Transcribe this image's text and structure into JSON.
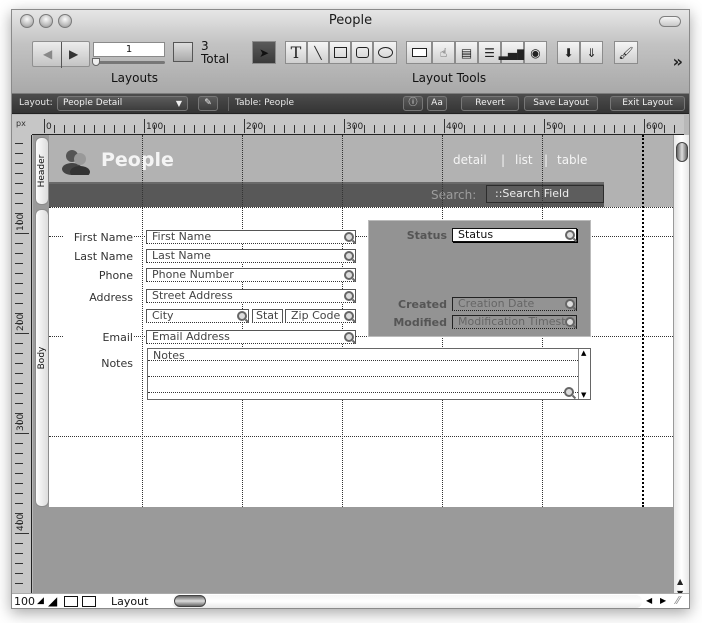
{
  "window": {
    "title": "People"
  },
  "toolbar": {
    "record_number": "1",
    "total_count": "3",
    "total_label": "Total",
    "layouts_label": "Layouts",
    "layout_tools_label": "Layout Tools",
    "more_label": "»",
    "tools": [
      "pointer",
      "text",
      "line",
      "rectangle",
      "rounded-rectangle",
      "oval",
      "field",
      "button",
      "tab-control",
      "portal",
      "chart",
      "web-viewer",
      "field-picker",
      "part-picker",
      "format-painter"
    ]
  },
  "statusbar": {
    "layout_label": "Layout:",
    "layout_value": "People Detail",
    "table_label": "Table: People",
    "revert": "Revert",
    "save": "Save Layout",
    "exit": "Exit Layout"
  },
  "ruler": {
    "unit": "px",
    "h_labels": [
      "0",
      "100",
      "200",
      "300",
      "400",
      "500",
      "600"
    ],
    "v_labels": [
      "100",
      "200",
      "300",
      "400"
    ]
  },
  "parts": {
    "header": "Header",
    "body": "Body"
  },
  "header": {
    "title": "People",
    "nav": [
      "detail",
      "|",
      "list",
      "|",
      "table"
    ],
    "search_label": "Search:",
    "search_field": "::Search Field"
  },
  "form": {
    "labels": {
      "first_name": "First Name",
      "last_name": "Last Name",
      "phone": "Phone",
      "address": "Address",
      "email": "Email",
      "notes": "Notes"
    },
    "fields": {
      "first_name": "First Name",
      "last_name": "Last Name",
      "phone": "Phone Number",
      "street": "Street Address",
      "city": "City",
      "state": "Stat",
      "zip": "Zip Code",
      "email": "Email Address",
      "notes": "Notes"
    },
    "status_panel": {
      "status_label": "Status",
      "status_field": "Status",
      "created_label": "Created",
      "created_field": "Creation Date",
      "modified_label": "Modified",
      "modified_field": "Modification Timest"
    }
  },
  "bottom": {
    "zoom": "100",
    "mode": "Layout"
  }
}
